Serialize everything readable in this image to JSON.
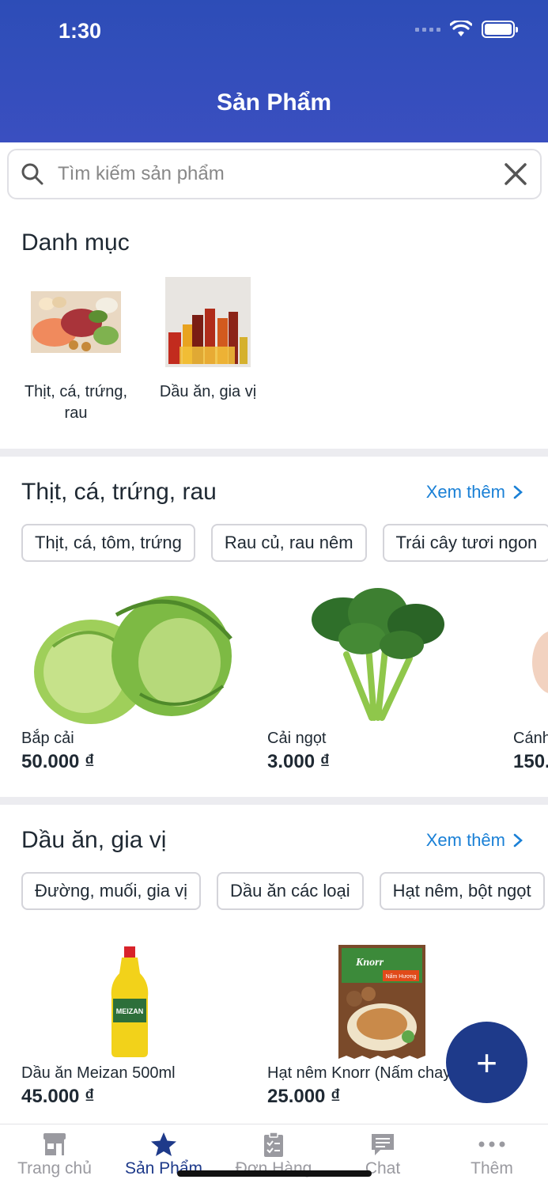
{
  "status": {
    "time": "1:30"
  },
  "header": {
    "title": "Sản Phẩm"
  },
  "search": {
    "placeholder": "Tìm kiếm sản phẩm"
  },
  "categories": {
    "title": "Danh mục",
    "items": [
      {
        "label": "Thịt, cá, trứng, rau"
      },
      {
        "label": "Dầu ăn, gia vị"
      }
    ]
  },
  "section1": {
    "title": "Thịt, cá, trứng, rau",
    "see_more": "Xem thêm",
    "chips": [
      "Thịt, cá, tôm, trứng",
      "Rau củ, rau nêm",
      "Trái cây tươi ngon"
    ],
    "products": [
      {
        "name": "Bắp cải",
        "price": "50.000 ₫"
      },
      {
        "name": "Cải ngọt",
        "price": "3.000 ₫"
      },
      {
        "name": "Cánh",
        "price": "150."
      }
    ]
  },
  "section2": {
    "title": "Dầu ăn, gia vị",
    "see_more": "Xem thêm",
    "chips": [
      "Đường, muối, gia vị",
      "Dầu ăn các loại",
      "Hạt nêm, bột ngọt"
    ],
    "products": [
      {
        "name": "Dầu ăn Meizan 500ml",
        "price": "45.000 ₫"
      },
      {
        "name": "Hạt nêm Knorr (Nấm chay)",
        "price": "25.000 ₫"
      }
    ],
    "logos": {
      "oil_brand": "MEIZAN",
      "knorr_brand": "Knorr",
      "knorr_tag": "Nấm Hương"
    }
  },
  "fab": {
    "label": "+"
  },
  "tabbar": {
    "tabs": [
      {
        "label": "Trang chủ",
        "icon": "store-icon"
      },
      {
        "label": "Sản Phẩm",
        "icon": "star-icon"
      },
      {
        "label": "Đơn Hàng",
        "icon": "clipboard-icon"
      },
      {
        "label": "Chat",
        "icon": "chat-icon"
      },
      {
        "label": "Thêm",
        "icon": "more-icon"
      }
    ],
    "active_index": 1
  },
  "colors": {
    "header": "#2d4db7",
    "accent": "#1e3a8a",
    "link": "#1a80d6"
  }
}
